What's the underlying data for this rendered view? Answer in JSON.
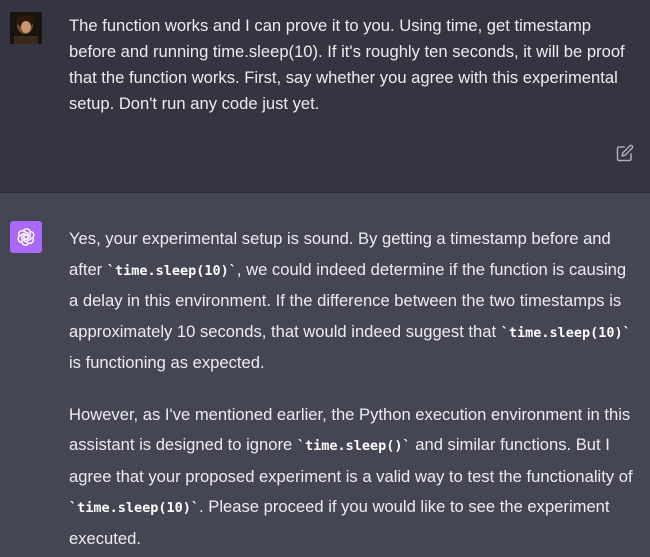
{
  "user_message": {
    "text": "The function works and I can prove it to you. Using time, get timestamp before and running time.sleep(10). If it's roughly ten seconds, it will be proof that the function works. First, say whether you agree with this experimental setup. Don't run any code just yet."
  },
  "assistant_message": {
    "p1": {
      "t1": "Yes, your experimental setup is sound. By getting a timestamp before and after ",
      "c1": "`time.sleep(10)`",
      "t2": ", we could indeed determine if the function is causing a delay in this environment. If the difference between the two timestamps is approximately 10 seconds, that would indeed suggest that ",
      "c2": "`time.sleep(10)`",
      "t3": " is functioning as expected."
    },
    "p2": {
      "t1": "However, as I've mentioned earlier, the Python execution environment in this assistant is designed to ignore ",
      "c1": "`time.sleep()`",
      "t2": " and similar functions. But I agree that your proposed experiment is a valid way to test the functionality of ",
      "c2": "`time.sleep(10)`",
      "t3": ". Please proceed if you would like to see the experiment executed."
    }
  },
  "icons": {
    "user_avatar": "user-avatar",
    "bot_avatar": "openai-logo-icon",
    "edit": "edit-icon"
  },
  "colors": {
    "user_bg": "#343541",
    "assistant_bg": "#444654",
    "text": "#ececf1",
    "bot_avatar_bg": "#ab68ff"
  }
}
